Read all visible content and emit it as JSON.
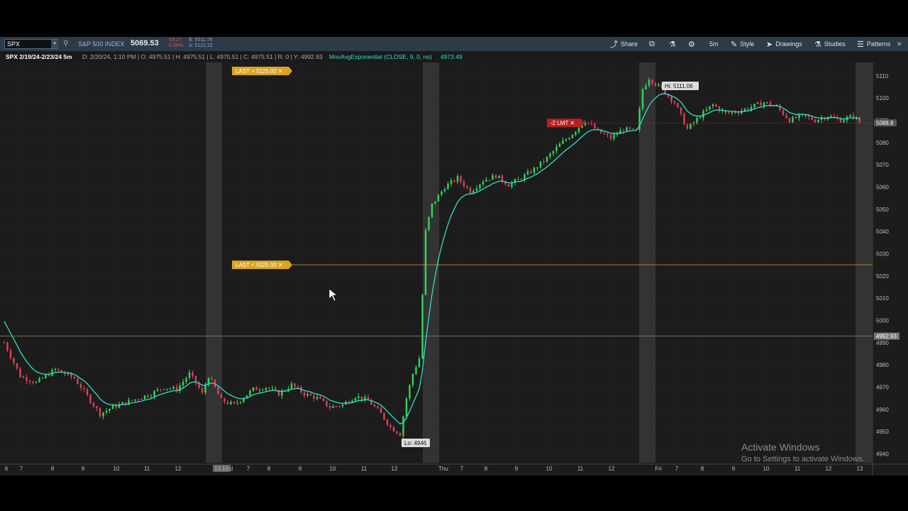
{
  "toolbar": {
    "symbol": "SPX",
    "symbol_dropdown": "▾",
    "description": "S&P 500 INDEX",
    "last": "5069.53",
    "net_change": "-19.27",
    "pct_change": "-0.38%",
    "bid": "B: 5011.78",
    "ask": "A: 5121.22",
    "buttons": {
      "share": "Share",
      "timeframe": "5m",
      "style": "Style",
      "drawings": "Drawings",
      "studies": "Studies",
      "patterns": "Patterns"
    },
    "icons": {
      "link": "link-icon",
      "share": "share-icon",
      "detach": "detach-window-icon",
      "flask": "flask-icon",
      "gear": "gear-icon",
      "style": "style-icon",
      "drawings": "cursor-icon",
      "studies": "flask-icon",
      "patterns": "patterns-icon"
    }
  },
  "infobar": {
    "title": "SPX 2/19/24-2/23/24 5m",
    "ohlc": "D: 2/20/24, 1:10 PM  |  O: 4975.51  |  H: 4975.51  |  L: 4975.51  |  C: 4975.51  |  R: 0  |  Y: 4992.93",
    "study": "MovAvgExponential (CLOSE, 9, 0, no)",
    "study_value": "4973.49"
  },
  "info_icon": "!",
  "chart_data": {
    "type": "candlestick",
    "yaxis": {
      "ticks": [
        5110,
        5100,
        5090,
        5080,
        5070,
        5060,
        5050,
        5040,
        5030,
        5020,
        5010,
        5000,
        4990,
        4980,
        4970,
        4960,
        4950,
        4940
      ],
      "range": [
        4936,
        5116
      ]
    },
    "xaxis_labels": [
      "6",
      "7",
      "8",
      "9",
      "10",
      "11",
      "12",
      "13:10",
      "d",
      "7",
      "8",
      "9",
      "10",
      "11",
      "12",
      "Thu",
      "7",
      "8",
      "9",
      "10",
      "11",
      "12",
      "Fri",
      "7",
      "8",
      "9",
      "10",
      "11",
      "12",
      "13"
    ],
    "price_path": [
      [
        0,
        4990
      ],
      [
        5,
        4975
      ],
      [
        10,
        4972
      ],
      [
        16,
        4978
      ],
      [
        22,
        4974
      ],
      [
        26,
        4966
      ],
      [
        30,
        4958
      ],
      [
        34,
        4961
      ],
      [
        40,
        4964
      ],
      [
        46,
        4967
      ],
      [
        50,
        4970
      ],
      [
        54,
        4969
      ],
      [
        58,
        4976
      ],
      [
        60,
        4972
      ],
      [
        62,
        4967
      ],
      [
        64,
        4975
      ],
      [
        68,
        4964
      ],
      [
        72,
        4962
      ],
      [
        78,
        4969
      ],
      [
        82,
        4970
      ],
      [
        86,
        4967
      ],
      [
        90,
        4971
      ],
      [
        94,
        4967
      ],
      [
        98,
        4965
      ],
      [
        102,
        4961
      ],
      [
        106,
        4962
      ],
      [
        110,
        4966
      ],
      [
        114,
        4964
      ],
      [
        118,
        4958
      ],
      [
        121,
        4952
      ],
      [
        124,
        4949
      ],
      [
        126,
        4965
      ],
      [
        128,
        4976
      ],
      [
        130,
        4983
      ],
      [
        132,
        5040
      ],
      [
        134,
        5052
      ],
      [
        138,
        5060
      ],
      [
        142,
        5064
      ],
      [
        146,
        5058
      ],
      [
        150,
        5063
      ],
      [
        154,
        5065
      ],
      [
        158,
        5061
      ],
      [
        162,
        5064
      ],
      [
        166,
        5068
      ],
      [
        170,
        5073
      ],
      [
        174,
        5079
      ],
      [
        178,
        5084
      ],
      [
        182,
        5090
      ],
      [
        186,
        5085
      ],
      [
        190,
        5082
      ],
      [
        194,
        5086
      ],
      [
        198,
        5085
      ],
      [
        200,
        5104
      ],
      [
        202,
        5109
      ],
      [
        206,
        5104
      ],
      [
        210,
        5098
      ],
      [
        214,
        5086
      ],
      [
        218,
        5092
      ],
      [
        222,
        5097
      ],
      [
        226,
        5093
      ],
      [
        230,
        5094
      ],
      [
        234,
        5096
      ],
      [
        238,
        5098
      ],
      [
        242,
        5096
      ],
      [
        246,
        5090
      ],
      [
        250,
        5092
      ],
      [
        254,
        5090
      ],
      [
        258,
        5092
      ],
      [
        262,
        5090
      ],
      [
        266,
        5092
      ],
      [
        268,
        5089
      ]
    ],
    "ema_color": "#2ee0c8",
    "bull_color": "#2fd85a",
    "bear_color": "#e0405a",
    "annotations": {
      "alert_high": "LAST > 5125.00 ✕",
      "alert_low": "LAST < 5025.00 ✕",
      "alert_low_price": 5025,
      "order": "-2 LMT ✕",
      "order_price": 5088.8,
      "order_label": "5088.8",
      "high_label": "Hi: 5111.06",
      "high_price": 5111.06,
      "low_label": "Lo: 4946",
      "low_price": 4946,
      "crosshair_price": 4992.93,
      "crosshair_label": "4992.93"
    },
    "colors": {
      "alert": "#d9a420",
      "order": "#b82020"
    }
  },
  "watermark": {
    "line1": "Activate Windows",
    "line2": "Go to Settings to activate Windows."
  }
}
